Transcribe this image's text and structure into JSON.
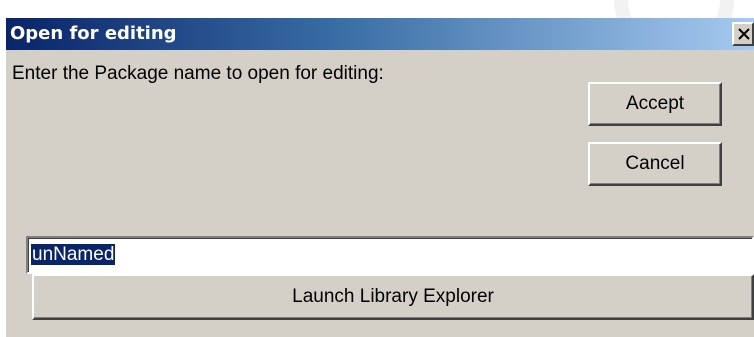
{
  "dialog": {
    "title": "Open for editing",
    "prompt": "Enter the Package name to open for editing:",
    "accept_label": "Accept",
    "cancel_label": "Cancel",
    "package_name_value": "unNamed",
    "launch_label": "Launch Library Explorer"
  },
  "icons": {
    "close": "close-icon"
  },
  "colors": {
    "titlebar_start": "#0a246a",
    "titlebar_end": "#a6caf0",
    "dialog_face": "#d4d0c8",
    "selection": "#0a246a"
  }
}
